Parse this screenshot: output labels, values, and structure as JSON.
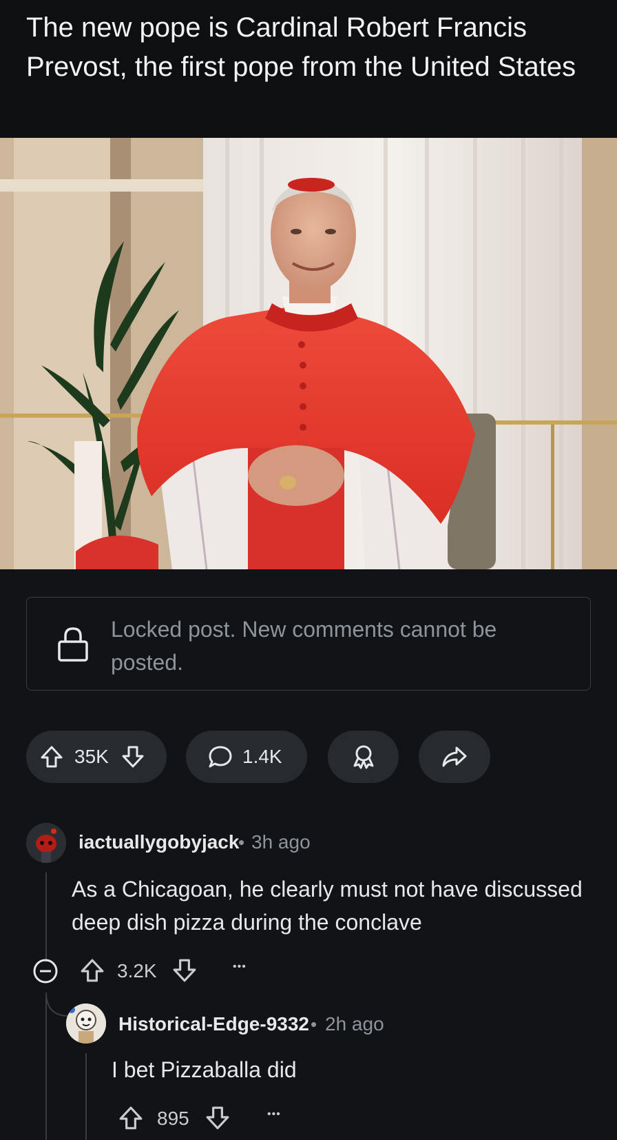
{
  "post": {
    "title": "The new pope is Cardinal Robert Francis Prevost, the first pope from the United States",
    "locked_notice": "Locked post. New comments cannot be posted.",
    "upvotes": "35K",
    "comments": "1.4K"
  },
  "icons": {
    "lock": "lock-icon",
    "upvote": "arrow-up-icon",
    "downvote": "arrow-down-icon",
    "comment": "speech-bubble-icon",
    "award": "award-icon",
    "share": "share-arrow-icon",
    "collapse": "minus-circle-icon",
    "more": "ellipsis-icon"
  },
  "comments": [
    {
      "username": "iactuallygobyjack",
      "separator": "•",
      "time": "3h ago",
      "body": "As a Chicagoan, he clearly must not have discussed deep dish pizza during the conclave",
      "votes": "3.2K",
      "more": "•••"
    },
    {
      "username": "Historical-Edge-9332",
      "separator": "•",
      "time": "2h ago",
      "body": "I bet Pizzaballa did",
      "votes": "895",
      "more": "•••"
    }
  ],
  "colors": {
    "background": "#111316",
    "pill": "#272a2f",
    "text": "#e6e8ea",
    "muted": "#8e949b",
    "cassock_red": "#e23b2e"
  }
}
